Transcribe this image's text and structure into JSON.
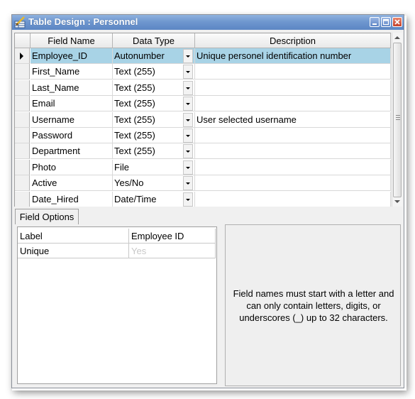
{
  "window": {
    "title": "Table Design : Personnel",
    "icon": "table-design-icon",
    "controls": [
      "minimize-icon",
      "maximize-icon",
      "close-icon"
    ]
  },
  "grid": {
    "columns": [
      "Field Name",
      "Data Type",
      "Description"
    ],
    "selected_row": 0,
    "rows": [
      {
        "field": "Employee_ID",
        "type": "Autonumber",
        "description": "Unique personel identification number"
      },
      {
        "field": "First_Name",
        "type": "Text (255)",
        "description": ""
      },
      {
        "field": "Last_Name",
        "type": "Text (255)",
        "description": ""
      },
      {
        "field": "Email",
        "type": "Text (255)",
        "description": ""
      },
      {
        "field": "Username",
        "type": "Text (255)",
        "description": "User selected username"
      },
      {
        "field": "Password",
        "type": "Text (255)",
        "description": ""
      },
      {
        "field": "Department",
        "type": "Text (255)",
        "description": ""
      },
      {
        "field": "Photo",
        "type": "File",
        "description": ""
      },
      {
        "field": "Active",
        "type": "Yes/No",
        "description": ""
      },
      {
        "field": "Date_Hired",
        "type": "Date/Time",
        "description": ""
      }
    ]
  },
  "field_options": {
    "tab_label": "Field Options",
    "rows": [
      {
        "name": "Label",
        "value": "Employee ID"
      },
      {
        "name": "Unique",
        "value": "Yes"
      }
    ]
  },
  "help_text": "Field names must start with a letter and can only contain letters, digits, or underscores (_) up to 32 characters.",
  "colors": {
    "title_bar": "#6f97cf",
    "selected_row": "#a8d3e6",
    "close_button": "#c4402a"
  }
}
